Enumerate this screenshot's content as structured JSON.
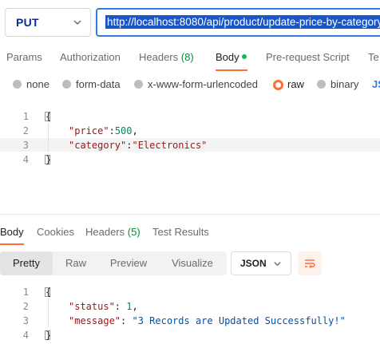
{
  "request": {
    "method": "PUT",
    "url": "http://localhost:8080/api/product/update-price-by-category"
  },
  "request_tabs": [
    {
      "label": "Params"
    },
    {
      "label": "Authorization"
    },
    {
      "label": "Headers",
      "count": "(8)"
    },
    {
      "label": "Body"
    },
    {
      "label": "Pre-request Script"
    },
    {
      "label": "Te"
    }
  ],
  "body_types": [
    {
      "label": "none"
    },
    {
      "label": "form-data"
    },
    {
      "label": "x-www-form-urlencoded"
    },
    {
      "label": "raw"
    },
    {
      "label": "binary"
    }
  ],
  "body_language_label": "JS",
  "request_body": {
    "line_numbers": [
      "1",
      "2",
      "3",
      "4"
    ],
    "open_brace": "{",
    "close_brace": "}",
    "price_key": "\"price\"",
    "price_value": "500",
    "category_key": "\"category\"",
    "category_value": "\"Electronics\""
  },
  "response_tabs": [
    {
      "label": "Body"
    },
    {
      "label": "Cookies"
    },
    {
      "label": "Headers",
      "count": "(5)"
    },
    {
      "label": "Test Results"
    }
  ],
  "response_views": [
    {
      "label": "Pretty"
    },
    {
      "label": "Raw"
    },
    {
      "label": "Preview"
    },
    {
      "label": "Visualize"
    }
  ],
  "response_format": "JSON",
  "response_body": {
    "line_numbers": [
      "1",
      "2",
      "3",
      "4"
    ],
    "open_brace": "{",
    "close_brace": "}",
    "status_key": "\"status\"",
    "status_value": "1",
    "message_key": "\"message\"",
    "message_value": "\"3 Records are Updated Successfully!\""
  },
  "colors": {
    "accent": "#ff6c37",
    "url_border": "#2f7de1",
    "success_dot": "#0cbb52"
  }
}
